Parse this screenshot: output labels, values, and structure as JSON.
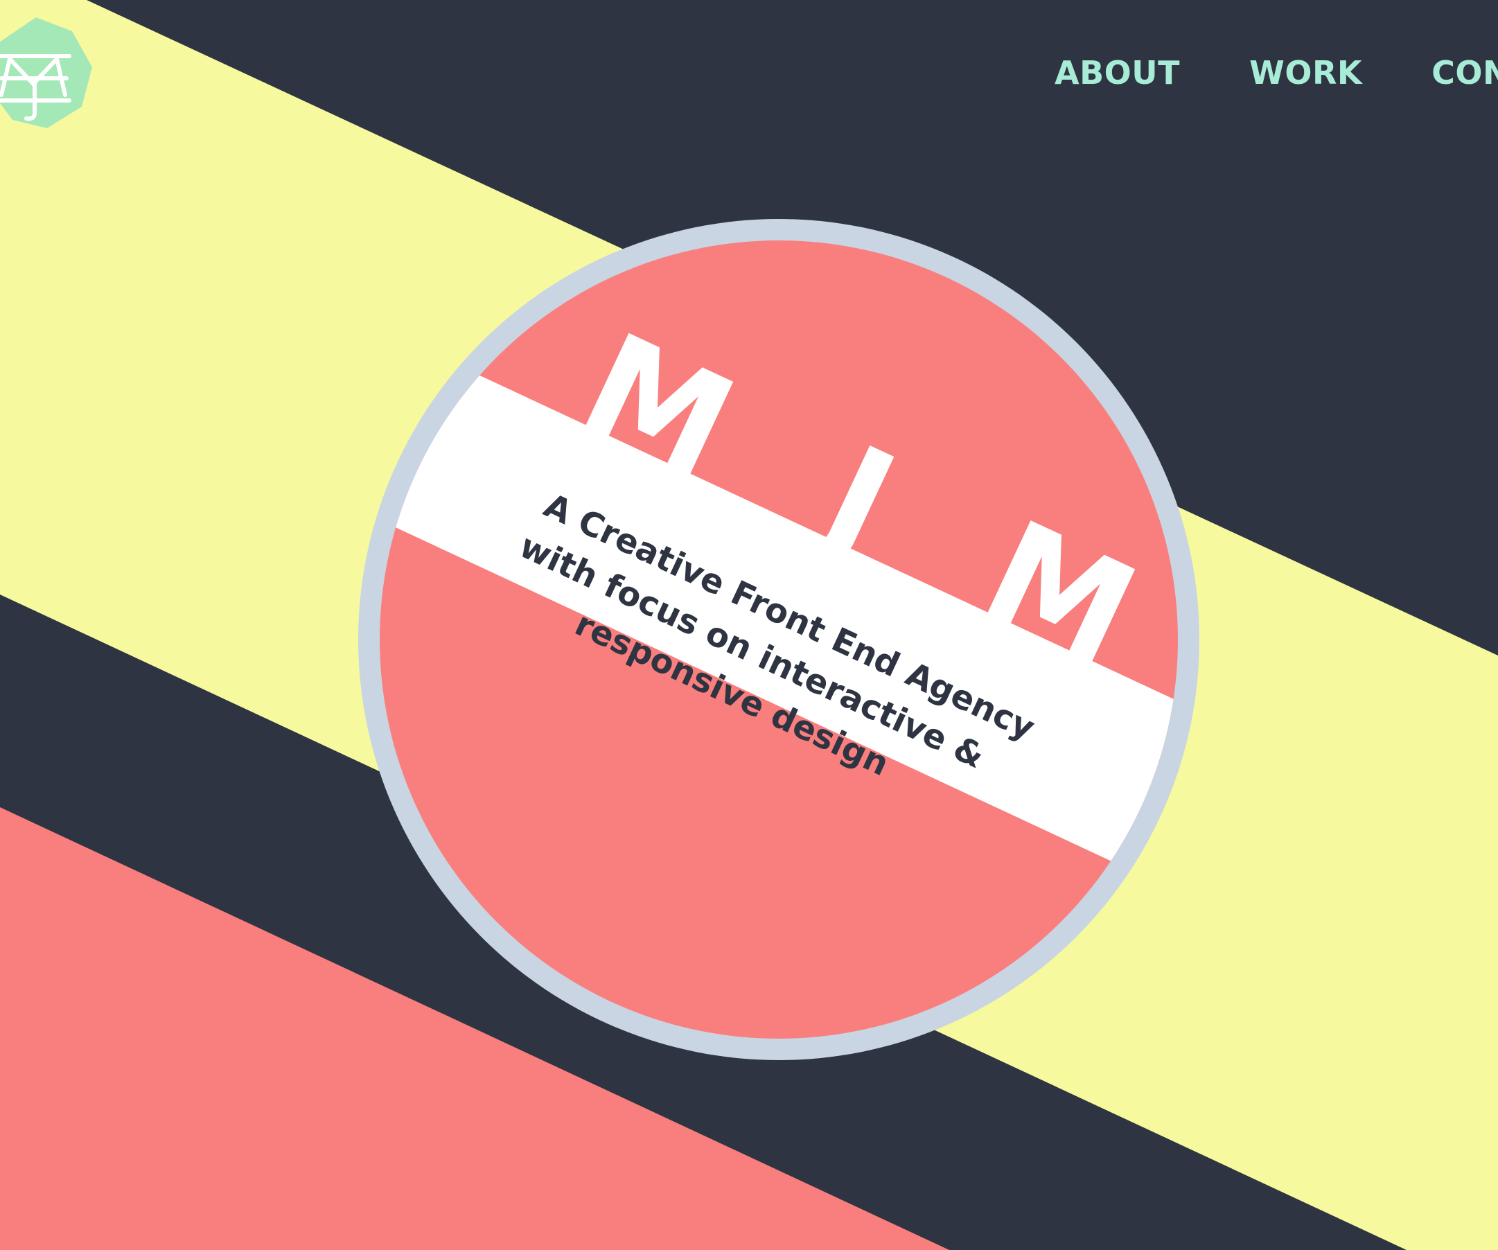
{
  "nav": {
    "items": [
      {
        "label": "ABOUT"
      },
      {
        "label": "WORK"
      },
      {
        "label": "CONTACT"
      }
    ]
  },
  "logo": {
    "glyph": "MJ",
    "background_color": "#a4e8b8",
    "mark_color": "#ffffff"
  },
  "hero": {
    "monogram": {
      "letters": [
        "M",
        "J",
        "M"
      ]
    },
    "tagline_lines": [
      "A Creative Front End Agency",
      "with focus on interactive &",
      "responsive design"
    ]
  },
  "colors": {
    "dark": "#2e3441",
    "yellow": "#f7f99e",
    "coral": "#f97f7e",
    "nav_text": "#a8ecd8",
    "ring": "#c9d5e2",
    "white": "#ffffff"
  }
}
